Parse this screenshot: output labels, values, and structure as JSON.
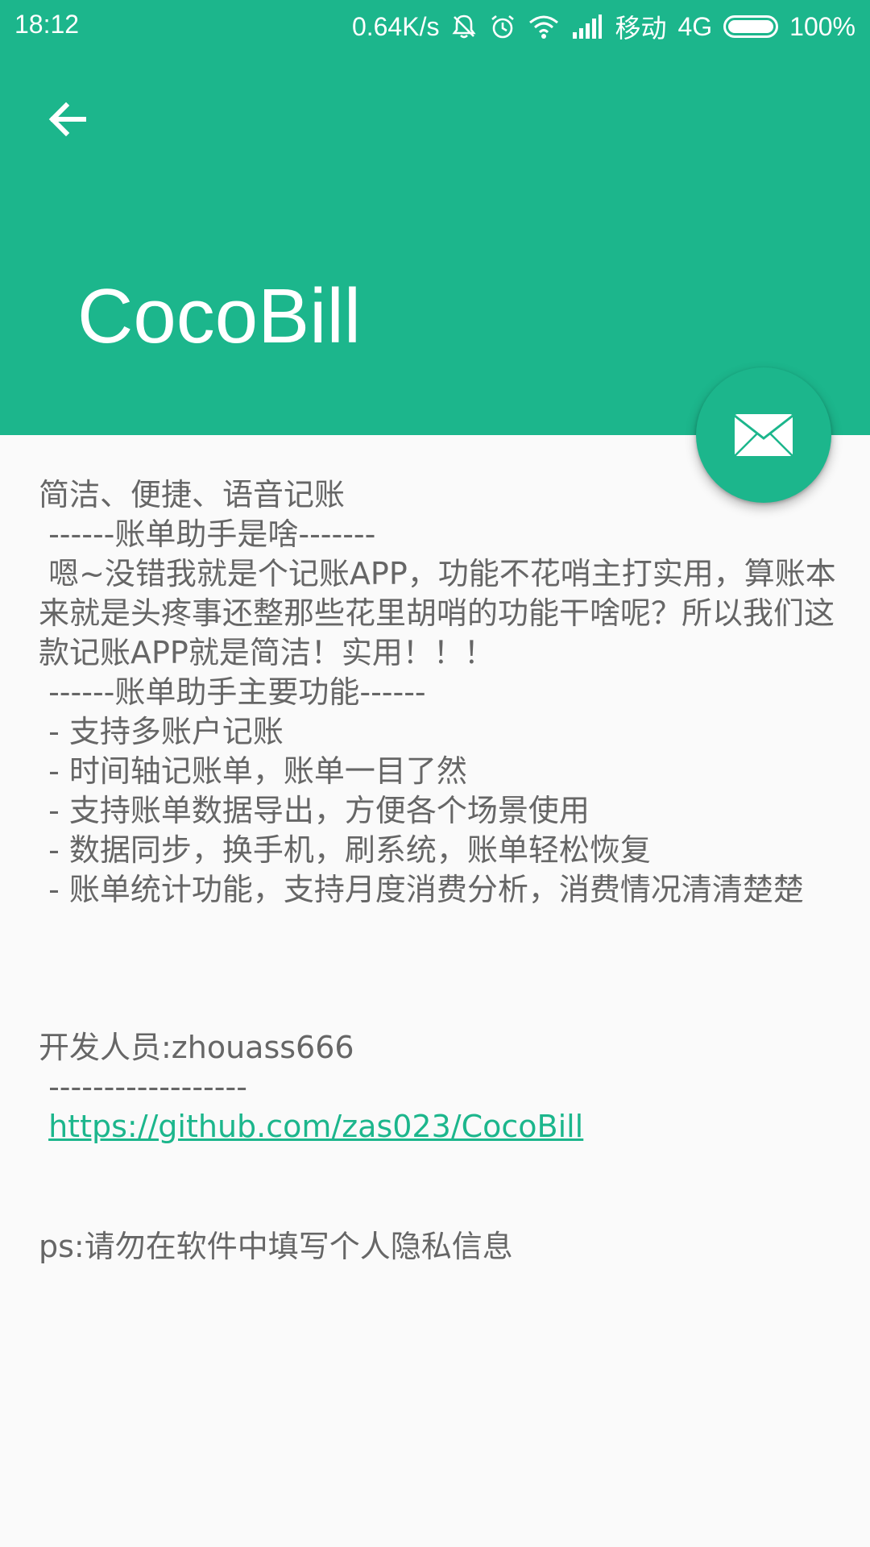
{
  "statusbar": {
    "time": "18:12",
    "network_speed": "0.64K/s",
    "carrier": "移动",
    "network_type": "4G",
    "battery": "100%",
    "icons": [
      "mute-icon",
      "alarm-icon",
      "wifi-icon",
      "signal-icon",
      "battery-icon"
    ]
  },
  "header": {
    "title": "CocoBill",
    "back_icon": "arrow-left-icon",
    "color": "#1cb68c"
  },
  "fab": {
    "icon": "mail-icon"
  },
  "content": {
    "lines": [
      "简洁、便捷、语音记账",
      " ------账单助手是啥-------",
      " 嗯~没错我就是个记账APP，功能不花哨主打实用，算账本来就是头疼事还整那些花里胡哨的功能干啥呢？所以我们这款记账APP就是简洁！实用！！！",
      " ------账单助手主要功能------",
      " - 支持多账户记账",
      " - 时间轴记账单，账单一目了然",
      " - 支持账单数据导出，方便各个场景使用",
      " - 数据同步，换手机，刷系统，账单轻松恢复",
      " - 账单统计功能，支持月度消费分析，消费情况清清楚楚"
    ],
    "developer": "开发人员:zhouass666",
    "separator": " ------------------",
    "link": "https://github.com/zas023/CocoBill",
    "note": "ps:请勿在软件中填写个人隐私信息"
  }
}
